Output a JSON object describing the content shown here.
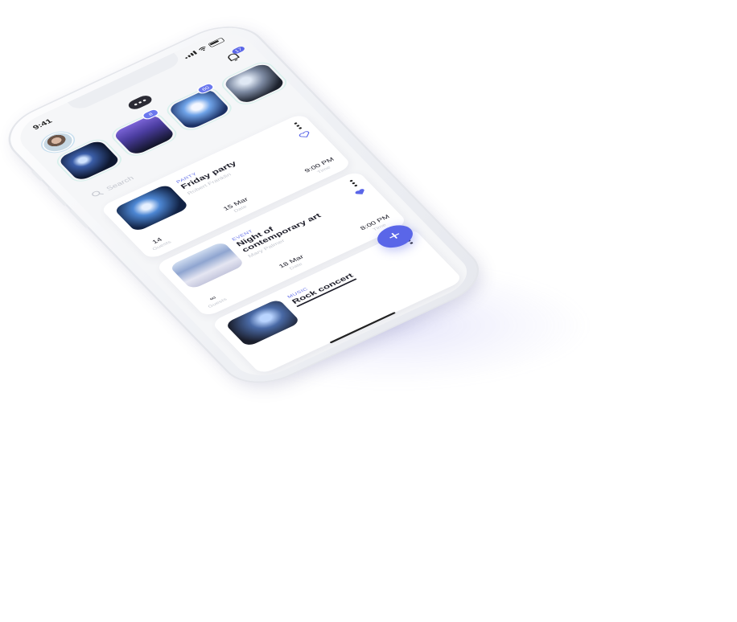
{
  "status_bar": {
    "time": "9:41"
  },
  "header": {
    "notification_count": "17",
    "menu_icon": "more-dots-icon",
    "avatar": "avatar-image"
  },
  "stories": [
    {
      "badge": ""
    },
    {
      "badge": "8"
    },
    {
      "badge": "60"
    },
    {
      "badge": ""
    }
  ],
  "search": {
    "placeholder": "Search"
  },
  "events": [
    {
      "category": "PARTY",
      "title": "Friday party",
      "host": "Robert Franklin",
      "guests_value": "14",
      "guests_label": "Guests",
      "date_value": "15 Mar",
      "date_label": "Date",
      "time_value": "9:00 PM",
      "time_label": "Time",
      "liked": false
    },
    {
      "category": "EVENT",
      "title": "Night of contemporary art",
      "host": "Mary Palmer",
      "guests_value": "∞",
      "guests_label": "Guests",
      "date_value": "18 Mar",
      "date_label": "Date",
      "time_value": "8:00 PM",
      "time_label": "Time",
      "liked": true
    },
    {
      "category": "MUSIC",
      "title": "Rock concert",
      "host": "",
      "guests_value": "",
      "guests_label": "",
      "date_value": "",
      "date_label": "",
      "time_value": "",
      "time_label": "",
      "liked": false
    }
  ],
  "fab": {
    "label": "+"
  },
  "colors": {
    "accent": "#5a66e8",
    "text": "#1c1c28",
    "muted": "#c5c8d0"
  }
}
